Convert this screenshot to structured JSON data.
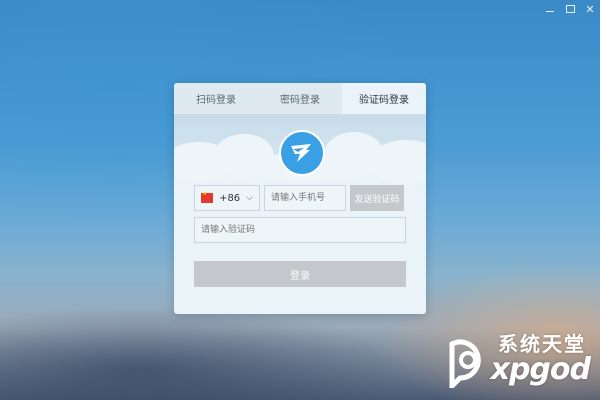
{
  "window": {
    "controls": [
      "minimize-icon",
      "maximize-icon",
      "close-icon"
    ],
    "close_glyph": "✕"
  },
  "login": {
    "tabs": [
      {
        "label": "扫码登录"
      },
      {
        "label": "密码登录"
      },
      {
        "label": "验证码登录",
        "active": true
      }
    ],
    "country_code": "+86",
    "phone_placeholder": "请输入手机号",
    "send_code_label": "发送验证码",
    "code_placeholder": "请输入验证码",
    "login_label": "登录",
    "icons": [
      "china-flag-icon",
      "chevron-down-icon",
      "dingtalk-logo-icon"
    ],
    "colors": {
      "accent": "#3aa0e6",
      "disabled_button": "#c4c8cd",
      "card_bg": "#eaf3f8"
    }
  },
  "watermark": {
    "top_text": "系统天堂",
    "bottom_text": "xpgod"
  }
}
